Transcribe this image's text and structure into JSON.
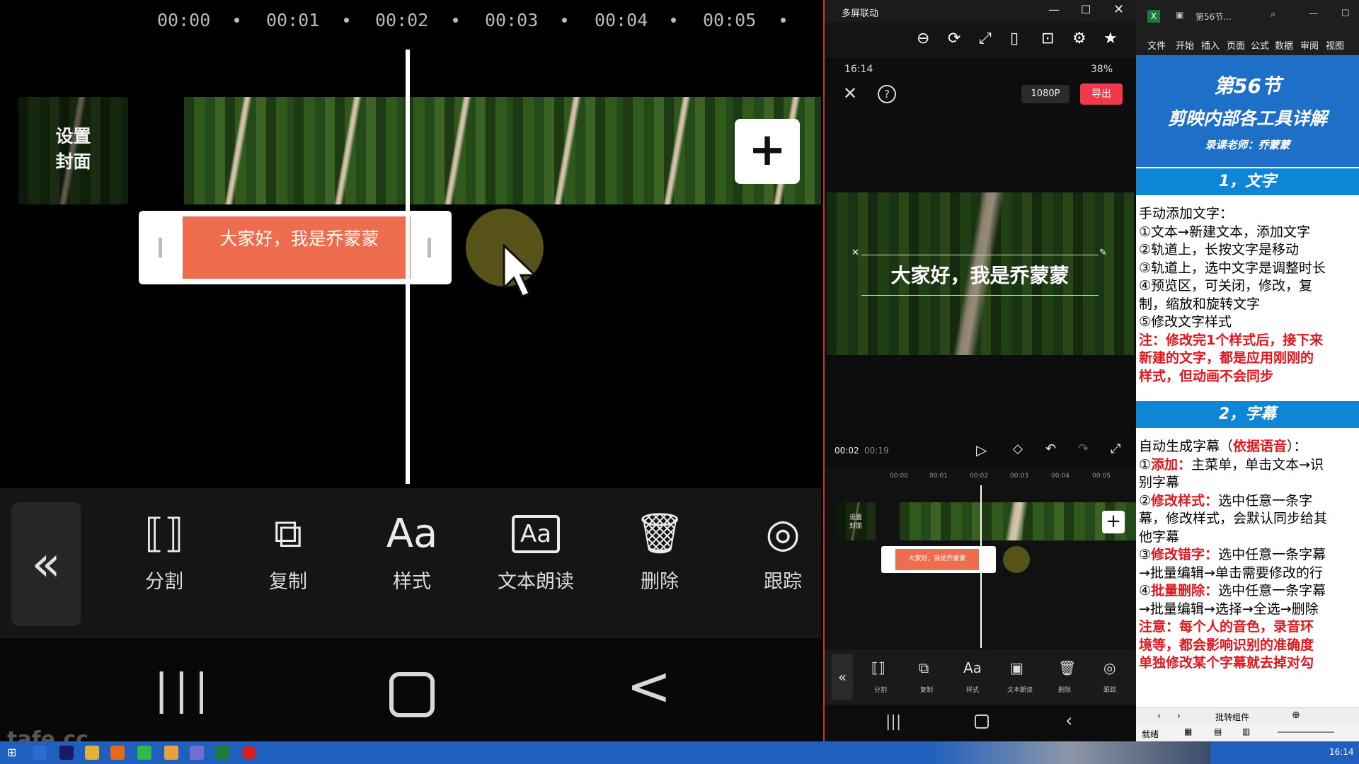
{
  "left_panel": {
    "ruler_times": [
      "00:00",
      "00:01",
      "00:02",
      "00:03",
      "00:04",
      "00:05"
    ],
    "cover_label_line1": "设置",
    "cover_label_line2": "封面",
    "add_clip_symbol": "+",
    "text_clip": "大家好，我是乔蒙蒙",
    "toolbar": {
      "back_symbol": "«",
      "items": [
        {
          "label": "分割",
          "icon": "split-icon",
          "glyph": "⟦⟧"
        },
        {
          "label": "复制",
          "icon": "copy-icon",
          "glyph": "⧉"
        },
        {
          "label": "样式",
          "icon": "style-icon",
          "glyph": "Aa"
        },
        {
          "label": "文本朗读",
          "icon": "text-to-speech-icon",
          "glyph": "Aa"
        },
        {
          "label": "删除",
          "icon": "trash-icon",
          "glyph": "🗑"
        },
        {
          "label": "跟踪",
          "icon": "track-icon",
          "glyph": "◎"
        }
      ]
    },
    "nav": {
      "recents": "|||",
      "home": "○",
      "back": "<"
    }
  },
  "phone_window": {
    "title": "多屏联动",
    "status_time": "16:14",
    "status_battery": "38%",
    "resolution": "1080P",
    "export_label": "导出",
    "preview_text": "大家好，我是乔蒙蒙",
    "time_current": "00:02",
    "time_total": "00:19",
    "ruler_times": [
      "00:00",
      "00:01",
      "00:02",
      "00:03",
      "00:04",
      "00:05"
    ],
    "cover_label_line1": "设置",
    "cover_label_line2": "封面",
    "text_clip": "大家好，我是乔蒙蒙",
    "toolbar_labels": [
      "分割",
      "复制",
      "样式",
      "文本朗读",
      "删除",
      "跟踪"
    ]
  },
  "excel": {
    "title": "第56节...",
    "menu": [
      "文件",
      "开始",
      "插入",
      "页面",
      "公式",
      "数据",
      "审阅",
      "视图"
    ],
    "banner_line1": "第56节",
    "banner_line2": "剪映内部各工具详解",
    "banner_line3": "录课老师：乔蒙蒙",
    "section1": "1，文字",
    "s1_lines": [
      "手动添加文字：",
      "①文本→新建文本，添加文字",
      "②轨道上，长按文字是移动",
      "③轨道上，选中文字是调整时长",
      "④预览区，可关闭，修改，复",
      "制，缩放和旋转文字",
      "⑤修改文字样式"
    ],
    "s1_note": [
      "注：修改完1个样式后，接下来",
      "新建的文字，都是应用刚刚的",
      "样式，但动画不会同步"
    ],
    "section2": "2，字幕",
    "s2_intro_a": "自动生成字幕（",
    "s2_intro_red": "依据语音",
    "s2_intro_b": "）：",
    "s2_items": [
      {
        "num": "①",
        "red": "添加：",
        "text": "主菜单，单击文本→识",
        "cont": "别字幕"
      },
      {
        "num": "②",
        "red": "修改样式：",
        "text": "选中任意一条字",
        "cont": "幕，修改样式，会默认同步给其"
      },
      {
        "num": "",
        "red": "",
        "text": "",
        "cont": "他字幕"
      },
      {
        "num": "③",
        "red": "修改错字：",
        "text": "选中任意一条字幕",
        "cont": "→批量编辑→单击需要修改的行"
      },
      {
        "num": "④",
        "red": "批量删除：",
        "text": "选中任意一条字幕",
        "cont": "→批量编辑→选择→全选→删除"
      }
    ],
    "s2_note": [
      "注意：每个人的音色，录音环",
      "境等，都会影响识别的准确度",
      "单独修改某个字幕就去掉对勾"
    ],
    "sheet_tab": "批转组件",
    "status_ready": "就绪",
    "clock": "16:14"
  },
  "colors": {
    "text_clip": "#ee6d4f",
    "export": "#f03a4b",
    "excel_blue": "#0d86d6",
    "excel_red": "#e0161c"
  },
  "watermark": "tafe.cc"
}
